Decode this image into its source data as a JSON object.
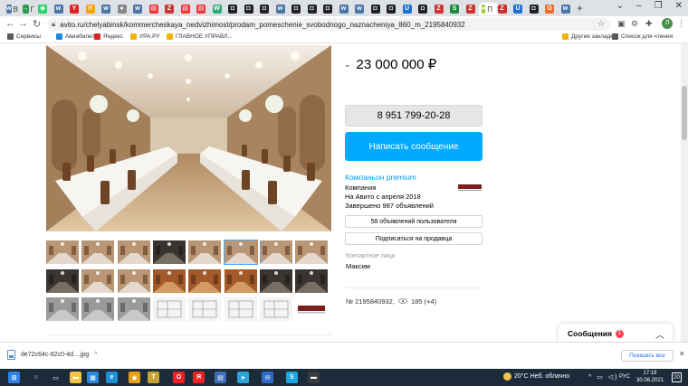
{
  "browser": {
    "tabs": [
      {
        "icon": "vk-icon",
        "label": "В",
        "color": "#4a76a8",
        "glyph": "w"
      },
      {
        "icon": "arrow-icon",
        "label": "Г",
        "color": "#2b9b4e",
        "glyph": "→"
      },
      {
        "icon": "whatsapp-icon",
        "label": "",
        "color": "#25d366",
        "glyph": "◉"
      },
      {
        "icon": "vk-icon",
        "label": "",
        "color": "#4a76a8",
        "glyph": "w"
      },
      {
        "icon": "yandex-icon",
        "label": "",
        "color": "#d22",
        "glyph": "Y"
      },
      {
        "icon": "mail-icon",
        "label": "",
        "color": "#f4a300",
        "glyph": "✉"
      },
      {
        "icon": "vk-icon",
        "label": "",
        "color": "#4a76a8",
        "glyph": "w"
      },
      {
        "icon": "avatar-icon",
        "label": "",
        "color": "#888",
        "glyph": "●"
      },
      {
        "icon": "vk-icon",
        "label": "",
        "color": "#4a76a8",
        "glyph": "w"
      },
      {
        "icon": "news-icon",
        "label": "",
        "color": "#e33",
        "glyph": "▤"
      },
      {
        "icon": "doc-icon",
        "label": "",
        "color": "#c33",
        "glyph": "Z"
      },
      {
        "icon": "news-icon",
        "label": "",
        "color": "#e33",
        "glyph": "▤"
      },
      {
        "icon": "news-icon",
        "label": "",
        "color": "#e33",
        "glyph": "▤"
      },
      {
        "icon": "map-icon",
        "label": "",
        "color": "#3a7",
        "glyph": "W"
      },
      {
        "icon": "camera-icon",
        "label": "",
        "color": "#222",
        "glyph": "◘"
      },
      {
        "icon": "camera-icon",
        "label": "",
        "color": "#222",
        "glyph": "◘"
      },
      {
        "icon": "camera-icon",
        "label": "",
        "color": "#222",
        "glyph": "◘"
      },
      {
        "icon": "vk-icon",
        "label": "",
        "color": "#4a76a8",
        "glyph": "w"
      },
      {
        "icon": "camera-icon",
        "label": "",
        "color": "#222",
        "glyph": "◘"
      },
      {
        "icon": "camera-icon",
        "label": "",
        "color": "#222",
        "glyph": "◘"
      },
      {
        "icon": "camera-icon",
        "label": "",
        "color": "#222",
        "glyph": "◘"
      },
      {
        "icon": "vk-icon",
        "label": "",
        "color": "#4a76a8",
        "glyph": "w"
      },
      {
        "icon": "vk-icon",
        "label": "",
        "color": "#4a76a8",
        "glyph": "w"
      },
      {
        "icon": "camera-icon",
        "label": "",
        "color": "#222",
        "glyph": "◘"
      },
      {
        "icon": "camera-icon",
        "label": "",
        "color": "#222",
        "glyph": "◘"
      },
      {
        "icon": "u-icon",
        "label": "",
        "color": "#1e6fd9",
        "glyph": "U"
      },
      {
        "icon": "camera-icon",
        "label": "",
        "color": "#222",
        "glyph": "◘"
      },
      {
        "icon": "z-icon",
        "label": "",
        "color": "#c33",
        "glyph": "Z"
      },
      {
        "icon": "sheet-icon",
        "label": "",
        "color": "#1d8b3e",
        "glyph": "S"
      },
      {
        "icon": "z-icon",
        "label": "",
        "color": "#c33",
        "glyph": "Z"
      },
      {
        "icon": "avito-icon",
        "label": "П",
        "color": "#97cf26",
        "glyph": "●",
        "active": true
      },
      {
        "icon": "z-icon",
        "label": "",
        "color": "#c33",
        "glyph": "Z"
      },
      {
        "icon": "u-icon",
        "label": "",
        "color": "#1e6fd9",
        "glyph": "U"
      },
      {
        "icon": "camera-icon",
        "label": "",
        "color": "#222",
        "glyph": "◘"
      },
      {
        "icon": "o-icon",
        "label": "",
        "color": "#f06a2a",
        "glyph": "O"
      },
      {
        "icon": "vk-icon",
        "label": "",
        "color": "#4a76a8",
        "glyph": "w"
      }
    ],
    "url": "avito.ru/chelyabinsk/kommercheskaya_nedvizhimost/prodam_pomeschenie_svobodnogo_naznacheniya_860_m_2195840932",
    "profile_letter": "Л",
    "bookmarks": [
      {
        "label": "Сервисы",
        "color": "#5b5b5b"
      },
      {
        "label": "Авиабилеты",
        "color": "#1e88e5"
      },
      {
        "label": "Яндекс",
        "color": "#d22"
      },
      {
        "label": "УРА.РУ",
        "color": "#f4b400"
      },
      {
        "label": "ГЛАВНОЕ УПРАВЛ...",
        "color": "#f4b400"
      }
    ],
    "bookmarks_right": [
      {
        "label": "Другие закладки",
        "color": "#f4b400"
      },
      {
        "label": "Список для чтения",
        "color": "#5b5b5b"
      }
    ]
  },
  "listing": {
    "price": "23 000 000 ₽",
    "phone": "8 951 799-20-28",
    "write_label": "Написать сообщение",
    "seller_name": "Компаньон premium",
    "seller_type": "Компания",
    "seller_since": "На Авито с апреля 2018",
    "seller_done": "Завершено 987 объявлений",
    "seller_ads_label": "58 объявлений пользователя",
    "subscribe_label": "Подписаться на продавца",
    "contact_label": "Контактное лицо",
    "contact_name": "Максим",
    "ad_number": "№ 2195840932,",
    "views": "185 (+4)",
    "thumbs": [
      {
        "kind": "hall"
      },
      {
        "kind": "hall"
      },
      {
        "kind": "hall"
      },
      {
        "kind": "dark"
      },
      {
        "kind": "hall"
      },
      {
        "kind": "selected"
      },
      {
        "kind": "hall"
      },
      {
        "kind": "hall"
      },
      {
        "kind": "dark"
      },
      {
        "kind": "hall"
      },
      {
        "kind": "hall"
      },
      {
        "kind": "warm"
      },
      {
        "kind": "warm"
      },
      {
        "kind": "warm"
      },
      {
        "kind": "dark"
      },
      {
        "kind": "dark"
      },
      {
        "kind": "gray"
      },
      {
        "kind": "gray"
      },
      {
        "kind": "gray"
      },
      {
        "kind": "plan"
      },
      {
        "kind": "plan"
      },
      {
        "kind": "plan"
      },
      {
        "kind": "plan"
      },
      {
        "kind": "logo"
      }
    ]
  },
  "messages_widget": {
    "title": "Сообщения",
    "badge": "1"
  },
  "downloads": {
    "file": "de72c64c-82c0-4d....jpg",
    "show_all": "Показать все"
  },
  "taskbar": {
    "apps": [
      {
        "icon": "windows-start-icon",
        "color": "#2f82e6",
        "glyph": "⊞"
      },
      {
        "icon": "search-icon",
        "color": "#1b2b3a",
        "glyph": "○"
      },
      {
        "icon": "task-view-icon",
        "color": "#1b2b3a",
        "glyph": "▭"
      },
      {
        "icon": "explorer-icon",
        "color": "#f4c542",
        "glyph": "▬"
      },
      {
        "icon": "store-icon",
        "color": "#2b88d8",
        "glyph": "▦"
      },
      {
        "icon": "edge-icon",
        "color": "#1c8fd8",
        "glyph": "e"
      },
      {
        "icon": "chrome-icon",
        "color": "#e3a21a",
        "glyph": "◉"
      },
      {
        "icon": "app-icon",
        "color": "#c8a33a",
        "glyph": "T"
      },
      {
        "icon": "opera-icon",
        "color": "#e22",
        "glyph": "O"
      },
      {
        "icon": "yandex-browser-icon",
        "color": "#e22",
        "glyph": "Я"
      },
      {
        "icon": "photos-icon",
        "color": "#3d6fb5",
        "glyph": "▤"
      },
      {
        "icon": "telegram-icon",
        "color": "#2aa3db",
        "glyph": "➤"
      },
      {
        "icon": "mail-icon",
        "color": "#2b6cc4",
        "glyph": "✉"
      },
      {
        "icon": "skype-icon",
        "color": "#1ea5e0",
        "glyph": "S"
      },
      {
        "icon": "terminal-icon",
        "color": "#3a3a3a",
        "glyph": "▬"
      }
    ],
    "weather": "20°C Неб. облачно",
    "lang": "РУС",
    "time": "17:18",
    "date": "30.08.2021",
    "notify": "20"
  }
}
